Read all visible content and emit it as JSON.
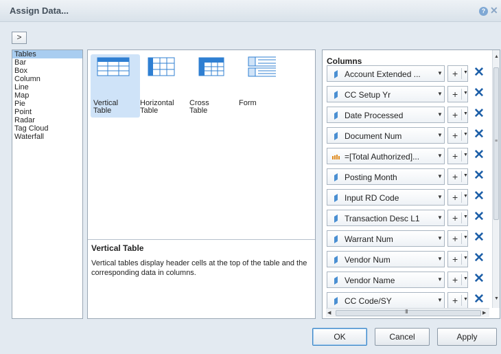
{
  "window": {
    "title": "Assign Data...",
    "help_glyph": "?",
    "close_glyph": "✕"
  },
  "toolbar": {
    "expand_label": ">"
  },
  "chart_types": [
    {
      "label": "Tables",
      "selected": true
    },
    {
      "label": "Bar"
    },
    {
      "label": "Box"
    },
    {
      "label": "Column"
    },
    {
      "label": "Line"
    },
    {
      "label": "Map"
    },
    {
      "label": "Pie"
    },
    {
      "label": "Point"
    },
    {
      "label": "Radar"
    },
    {
      "label": "Tag Cloud"
    },
    {
      "label": "Waterfall"
    }
  ],
  "table_options": [
    {
      "label": "Vertical Table",
      "line1": "Vertical",
      "line2": "Table",
      "icon": "vertical-table-icon",
      "selected": true
    },
    {
      "label": "Horizontal Table",
      "line1": "Horizontal",
      "line2": "Table",
      "icon": "horizontal-table-icon"
    },
    {
      "label": "Cross Table",
      "line1": "Cross",
      "line2": "Table",
      "icon": "cross-table-icon"
    },
    {
      "label": "Form",
      "line1": "Form",
      "line2": "",
      "icon": "form-icon"
    }
  ],
  "description": {
    "title": "Vertical Table",
    "text": "Vertical tables display header cells at the top of the table and the corresponding data in columns."
  },
  "columns_panel": {
    "title": "Columns",
    "dropdown_glyph": "▼",
    "plus_glyph": "+",
    "remove_glyph": "✕",
    "scroll_grip": "III",
    "rows": [
      {
        "label": "Account Extended ...",
        "kind": "dimension"
      },
      {
        "label": "CC Setup Yr",
        "kind": "dimension"
      },
      {
        "label": "Date Processed",
        "kind": "dimension"
      },
      {
        "label": "Document Num",
        "kind": "dimension"
      },
      {
        "label": "=[Total Authorized]...",
        "kind": "measure"
      },
      {
        "label": "Posting Month",
        "kind": "dimension"
      },
      {
        "label": "Input RD Code",
        "kind": "dimension"
      },
      {
        "label": "Transaction Desc L1",
        "kind": "dimension"
      },
      {
        "label": "Warrant Num",
        "kind": "dimension"
      },
      {
        "label": "Vendor Num",
        "kind": "dimension"
      },
      {
        "label": "Vendor Name",
        "kind": "dimension"
      },
      {
        "label": "CC Code/SY",
        "kind": "dimension"
      }
    ]
  },
  "buttons": {
    "ok": "OK",
    "cancel": "Cancel",
    "apply": "Apply"
  },
  "colors": {
    "dimension_icon": "#4a8fd2",
    "measure_icon": "#e08a1c",
    "remove_icon": "#1d5fa8",
    "selection": "#a9cdf0"
  }
}
